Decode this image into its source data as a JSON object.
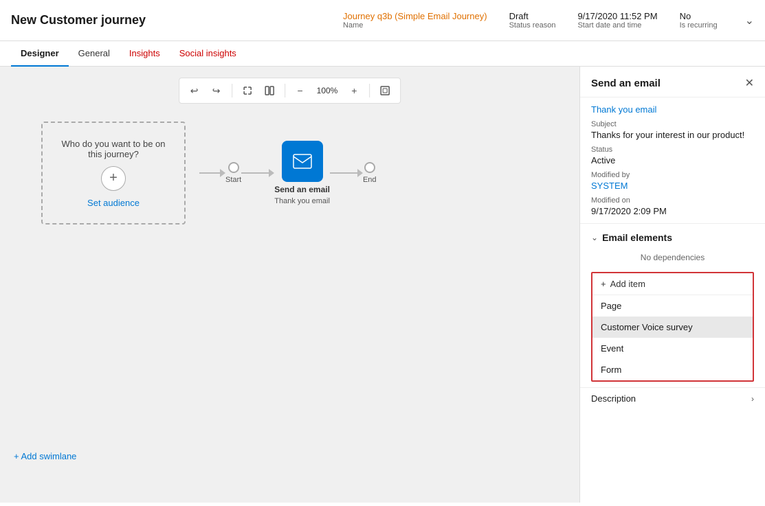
{
  "header": {
    "title": "New Customer journey",
    "meta": {
      "name_value": "Journey q3b (Simple Email Journey)",
      "name_label": "Name",
      "status_value": "Draft",
      "status_label": "Status reason",
      "start_date_value": "9/17/2020 11:52 PM",
      "start_date_label": "Start date and time",
      "recurring_value": "No",
      "recurring_label": "Is recurring"
    }
  },
  "tabs": [
    {
      "id": "designer",
      "label": "Designer",
      "active": true
    },
    {
      "id": "general",
      "label": "General",
      "active": false
    },
    {
      "id": "insights",
      "label": "Insights",
      "active": false,
      "style": "red"
    },
    {
      "id": "social-insights",
      "label": "Social insights",
      "active": false,
      "style": "red"
    }
  ],
  "toolbar": {
    "undo_icon": "↩",
    "redo_icon": "↪",
    "expand_icon": "↗",
    "columns_icon": "⊞",
    "zoom_out_icon": "−",
    "zoom_level": "100%",
    "zoom_in_icon": "+",
    "fit_icon": "⊡"
  },
  "canvas": {
    "audience_text": "Who do you want to be on this journey?",
    "audience_link": "Set audience",
    "start_label": "Start",
    "end_label": "End",
    "email_node_label": "Send an email",
    "email_node_sub": "Thank you email",
    "add_swimlane_label": "+ Add swimlane"
  },
  "panel": {
    "title": "Send an email",
    "close_icon": "✕",
    "link_text": "Thank you email",
    "subject_label": "Subject",
    "subject_value": "Thanks for your interest in our product!",
    "status_label": "Status",
    "status_value": "Active",
    "modified_by_label": "Modified by",
    "modified_by_value": "SYSTEM",
    "modified_on_label": "Modified on",
    "modified_on_value": "9/17/2020 2:09 PM",
    "email_elements_label": "Email elements",
    "chevron_down": "∨",
    "no_dependencies": "No dependencies",
    "add_item_label": "+ Add item",
    "dropdown_items": [
      {
        "id": "page",
        "label": "Page"
      },
      {
        "id": "customer-voice",
        "label": "Customer Voice survey",
        "selected": true
      },
      {
        "id": "event",
        "label": "Event"
      },
      {
        "id": "form",
        "label": "Form"
      }
    ],
    "description_label": "Description",
    "description_chevron": "›"
  }
}
